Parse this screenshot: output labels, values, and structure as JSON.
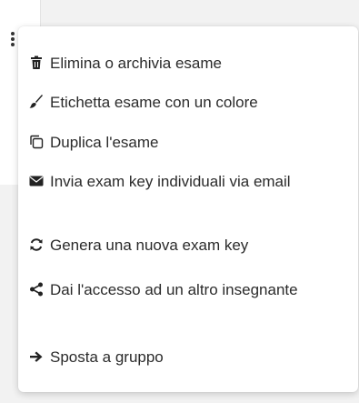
{
  "menu": {
    "items": [
      {
        "label": "Elimina o archivia esame",
        "icon": "trash-icon"
      },
      {
        "label": "Etichetta esame con un colore",
        "icon": "paint-brush-icon"
      },
      {
        "label": "Duplica l'esame",
        "icon": "copy-icon"
      },
      {
        "label": "Invia exam key individuali via email",
        "icon": "envelope-icon"
      },
      {
        "label": "Genera una nuova exam key",
        "icon": "refresh-icon"
      },
      {
        "label": "Dai l'accesso ad un altro insegnante",
        "icon": "share-icon"
      },
      {
        "label": "Sposta a gruppo",
        "icon": "arrow-right-icon"
      }
    ]
  },
  "trigger": {
    "icon": "kebab-menu-icon"
  },
  "colors": {
    "text": "#2b2b2b",
    "icon": "#222222",
    "menu_bg": "#ffffff",
    "page_bg": "#f2f2f2"
  }
}
